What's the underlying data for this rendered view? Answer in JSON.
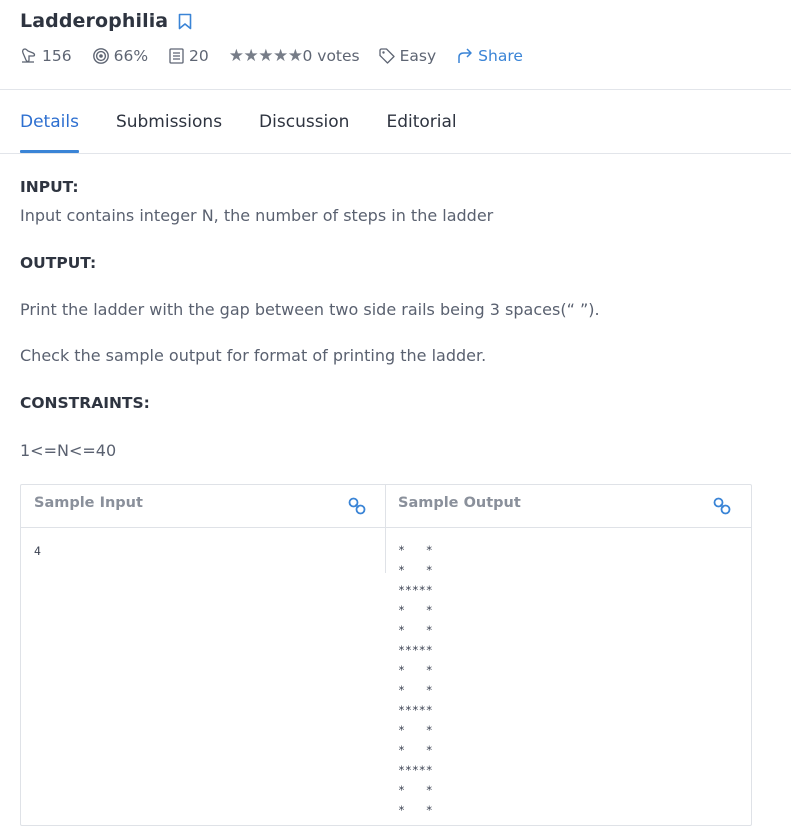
{
  "problem": {
    "title": "Ladderophilia"
  },
  "meta": {
    "attempts": "156",
    "success_rate": "66%",
    "submissions": "20",
    "stars": "★★★★★",
    "votes": "0 votes",
    "difficulty": "Easy",
    "share_label": "Share"
  },
  "tabs": [
    {
      "label": "Details",
      "active": true
    },
    {
      "label": "Submissions",
      "active": false
    },
    {
      "label": "Discussion",
      "active": false
    },
    {
      "label": "Editorial",
      "active": false
    }
  ],
  "body": {
    "input_heading": "INPUT:",
    "input_text": "Input contains integer N, the number of steps in the ladder",
    "output_heading": "OUTPUT:",
    "output_text": "Print the ladder with the gap between two side rails being 3 spaces(“   ”).",
    "check_text": "Check the sample output for format of printing the ladder.",
    "constraints_heading": "CONSTRAINTS:",
    "constraints_text": "1<=N<=40"
  },
  "sample": {
    "input_label": "Sample Input",
    "output_label": "Sample Output",
    "input_value": "4",
    "output_value": "*   *\n*   *\n*****\n*   *\n*   *\n*****\n*   *\n*   *\n*****\n*   *\n*   *\n*****\n*   *\n*   *"
  },
  "colors": {
    "accent": "#3a84d6",
    "text": "#2e3440",
    "muted": "#5e6573"
  },
  "icons": [
    "bookmark-icon",
    "attempts-icon",
    "target-icon",
    "list-icon",
    "tag-icon",
    "share-icon",
    "link-icon"
  ]
}
